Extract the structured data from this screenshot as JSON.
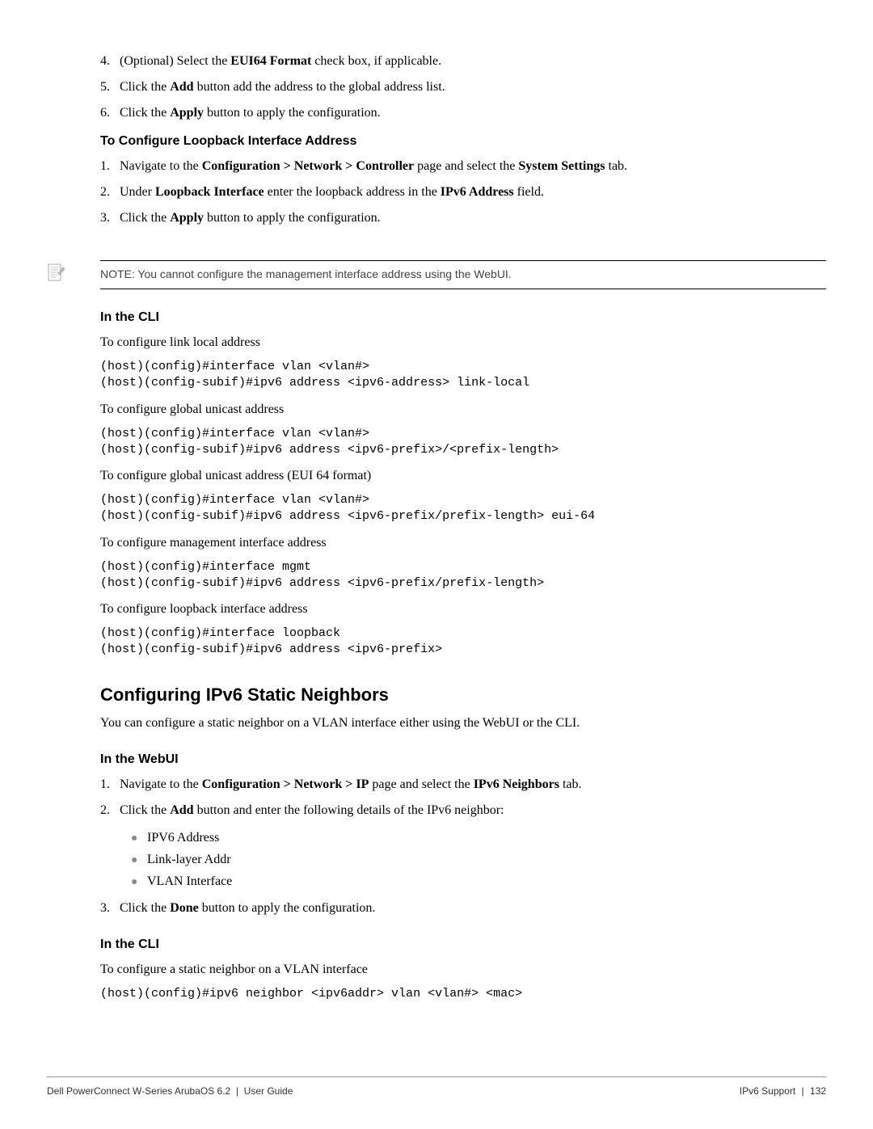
{
  "top_list": [
    {
      "num": "4.",
      "pre": "(Optional) Select the ",
      "bold": "EUI64 Format",
      "post": " check box, if applicable."
    },
    {
      "num": "5.",
      "pre": "Click the ",
      "bold": "Add",
      "post": " button add the address to the global address list."
    },
    {
      "num": "6.",
      "pre": "Click the ",
      "bold": "Apply",
      "post": " button to apply the configuration."
    }
  ],
  "loopback_heading": "To Configure Loopback Interface Address",
  "loopback_list": [
    {
      "num": "1.",
      "segments": [
        {
          "t": "Navigate to the "
        },
        {
          "t": "Configuration > Network > Controller",
          "b": true
        },
        {
          "t": " page and select the "
        },
        {
          "t": "System Settings",
          "b": true
        },
        {
          "t": " tab."
        }
      ]
    },
    {
      "num": "2.",
      "segments": [
        {
          "t": "Under "
        },
        {
          "t": "Loopback Interface",
          "b": true
        },
        {
          "t": " enter the loopback address in the "
        },
        {
          "t": "IPv6 Address",
          "b": true
        },
        {
          "t": " field."
        }
      ]
    },
    {
      "num": "3.",
      "segments": [
        {
          "t": "Click the "
        },
        {
          "t": "Apply",
          "b": true
        },
        {
          "t": " button to apply the configuration."
        }
      ]
    }
  ],
  "note": "NOTE: You cannot configure the management interface address using the WebUI.",
  "cli1_heading": "In the CLI",
  "cli1": [
    {
      "desc": "To configure link local address",
      "code": "(host)(config)#interface vlan <vlan#>\n(host)(config-subif)#ipv6 address <ipv6-address> link-local"
    },
    {
      "desc": "To configure global unicast address",
      "code": "(host)(config)#interface vlan <vlan#>\n(host)(config-subif)#ipv6 address <ipv6-prefix>/<prefix-length>"
    },
    {
      "desc": "To configure global unicast address (EUI 64 format)",
      "code": "(host)(config)#interface vlan <vlan#>\n(host)(config-subif)#ipv6 address <ipv6-prefix/prefix-length> eui-64"
    },
    {
      "desc": "To configure management interface address",
      "code": "(host)(config)#interface mgmt\n(host)(config-subif)#ipv6 address <ipv6-prefix/prefix-length>"
    },
    {
      "desc": "To configure loopback interface address",
      "code": "(host)(config)#interface loopback\n(host)(config-subif)#ipv6 address <ipv6-prefix>"
    }
  ],
  "section2_heading": "Configuring IPv6 Static Neighbors",
  "section2_intro": "You can configure a static neighbor on a VLAN interface either using the WebUI or the CLI.",
  "webui_heading": "In the WebUI",
  "webui_list": [
    {
      "num": "1.",
      "segments": [
        {
          "t": "Navigate to the "
        },
        {
          "t": "Configuration > Network > IP",
          "b": true
        },
        {
          "t": " page and select the "
        },
        {
          "t": "IPv6 Neighbors",
          "b": true
        },
        {
          "t": " tab."
        }
      ]
    },
    {
      "num": "2.",
      "segments": [
        {
          "t": "Click the "
        },
        {
          "t": "Add",
          "b": true
        },
        {
          "t": " button and enter the following details of the IPv6 neighbor:"
        }
      ],
      "bullets": [
        "IPV6 Address",
        "Link-layer Addr",
        "VLAN Interface"
      ]
    },
    {
      "num": "3.",
      "segments": [
        {
          "t": "Click the "
        },
        {
          "t": "Done",
          "b": true
        },
        {
          "t": " button to apply the configuration."
        }
      ]
    }
  ],
  "cli2_heading": "In the CLI",
  "cli2_desc": "To configure a static neighbor on a VLAN interface",
  "cli2_code": "(host)(config)#ipv6 neighbor <ipv6addr> vlan <vlan#> <mac>",
  "footer_left": "Dell PowerConnect W-Series ArubaOS 6.2",
  "footer_left2": "User Guide",
  "footer_right1": "IPv6 Support",
  "footer_right2": "132"
}
